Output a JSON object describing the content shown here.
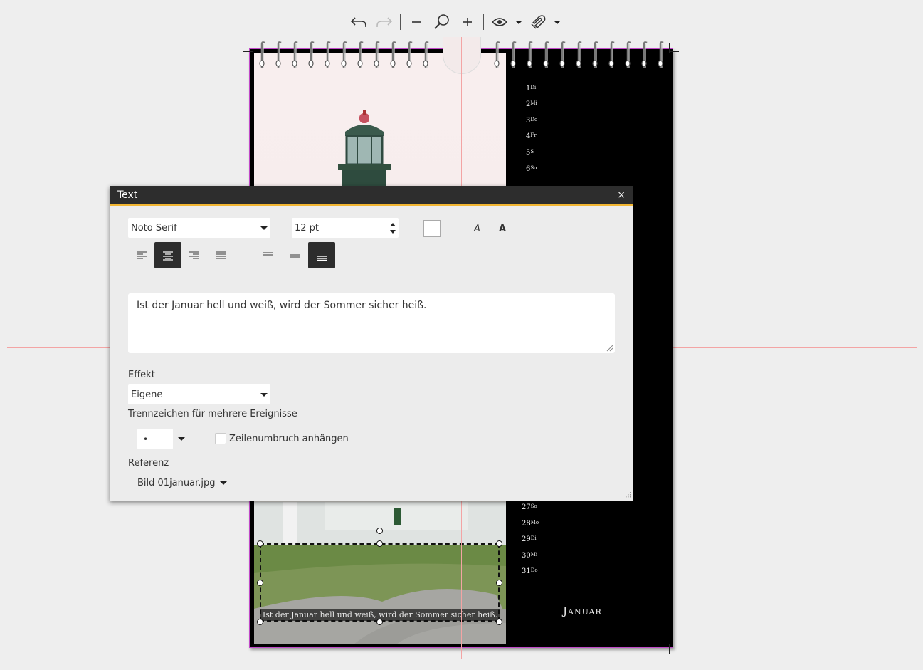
{
  "toolbar": {
    "items": [
      "undo-icon",
      "redo-icon",
      "zoom-out-icon",
      "zoom-fit-icon",
      "zoom-in-icon",
      "preview-eye-icon",
      "magnet-icon"
    ]
  },
  "calendar": {
    "days_top": [
      {
        "num": "1",
        "wd": "Di"
      },
      {
        "num": "2",
        "wd": "Mi"
      },
      {
        "num": "3",
        "wd": "Do"
      },
      {
        "num": "4",
        "wd": "Fr"
      },
      {
        "num": "5",
        "wd": "S"
      },
      {
        "num": "6",
        "wd": "So"
      }
    ],
    "days_bottom": [
      {
        "num": "27",
        "wd": "So"
      },
      {
        "num": "28",
        "wd": "Mo"
      },
      {
        "num": "29",
        "wd": "Di"
      },
      {
        "num": "30",
        "wd": "Mi"
      },
      {
        "num": "31",
        "wd": "Do"
      }
    ],
    "month": "Januar",
    "photo_caption": "Ist der Januar hell und weiß, wird der Sommer sicher heiß."
  },
  "dialog": {
    "title": "Text",
    "close_label": "×",
    "font_family": "Noto Serif",
    "font_size": "12 pt",
    "italic_label": "A",
    "bold_label": "A",
    "text_value": "Ist der Januar hell und weiß, wird der Sommer sicher heiß.",
    "effect_label": "Effekt",
    "effect_value": "Eigene",
    "separator_label": "Trennzeichen für mehrere Ereignisse",
    "separator_value": "•",
    "linebreak_label": "Zeilenumbruch anhängen",
    "reference_label": "Referenz",
    "reference_value": "Bild 01januar.jpg"
  }
}
